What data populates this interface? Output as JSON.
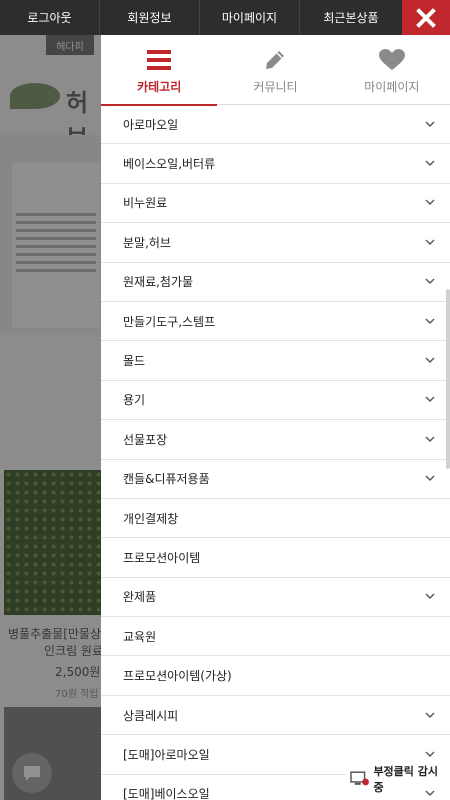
{
  "topbar": {
    "logout": "로그아웃",
    "member_info": "회원정보",
    "my_page": "마이페이지",
    "recent_items": "최근본상품",
    "close_icon": "close-icon"
  },
  "background": {
    "logo_text": "헤다피",
    "brand_text": "허브",
    "product_name_1": "병풀추출물[만물상",
    "product_name_2": "인크림 원료",
    "price": "2,500원",
    "points": "70원 적립"
  },
  "tabs": [
    {
      "label": "카테고리",
      "icon": "menu-icon",
      "active": true
    },
    {
      "label": "커뮤니티",
      "icon": "pencil-icon",
      "active": false
    },
    {
      "label": "마이페이지",
      "icon": "heart-icon",
      "active": false
    }
  ],
  "categories": [
    {
      "label": "아로마오일",
      "has_sub": true
    },
    {
      "label": "베이스오일,버터류",
      "has_sub": true
    },
    {
      "label": "비누원료",
      "has_sub": true
    },
    {
      "label": "분말,허브",
      "has_sub": true
    },
    {
      "label": "원재료,첨가물",
      "has_sub": true
    },
    {
      "label": "만들기도구,스템프",
      "has_sub": true
    },
    {
      "label": "몰드",
      "has_sub": true
    },
    {
      "label": "용기",
      "has_sub": true
    },
    {
      "label": "선물포장",
      "has_sub": true
    },
    {
      "label": "캔들&디퓨저용품",
      "has_sub": true
    },
    {
      "label": "개인결제창",
      "has_sub": false
    },
    {
      "label": "프로모션아이템",
      "has_sub": false
    },
    {
      "label": "완제품",
      "has_sub": true
    },
    {
      "label": "교육원",
      "has_sub": false
    },
    {
      "label": "프로모션아이템(가상)",
      "has_sub": false
    },
    {
      "label": "상큼레시피",
      "has_sub": true
    },
    {
      "label": "[도매]아로마오일",
      "has_sub": true
    },
    {
      "label": "[도매]베이스오일",
      "has_sub": true
    }
  ],
  "fraud_badge": {
    "label": "부정클릭 감시중",
    "icon": "monitor-icon"
  },
  "colors": {
    "accent": "#c0272d",
    "topbar_bg": "#2d2d2d"
  }
}
